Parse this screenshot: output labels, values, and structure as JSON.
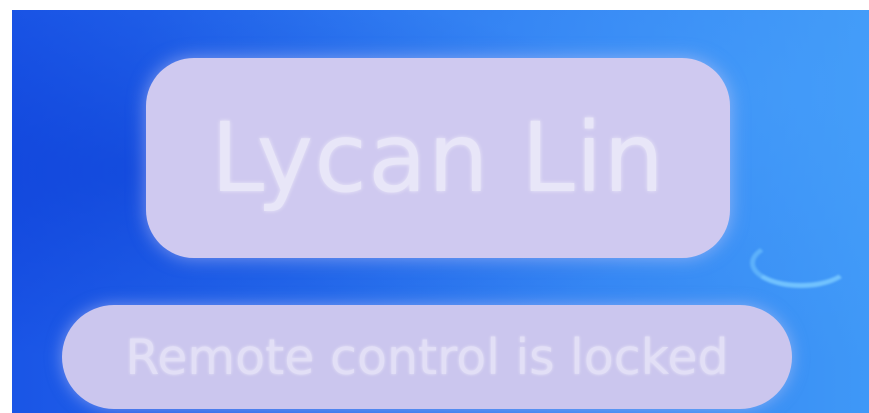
{
  "remote_session": {
    "user_name": "Lycan Lin",
    "status_message": "Remote control is locked"
  },
  "icons": {
    "spinner": "loading-spinner-icon"
  },
  "colors": {
    "background_primary": "#2a74ef",
    "pill_background": "#cfc9f0",
    "pill_text": "#e8e6f8",
    "spinner": "#78c8ff"
  }
}
